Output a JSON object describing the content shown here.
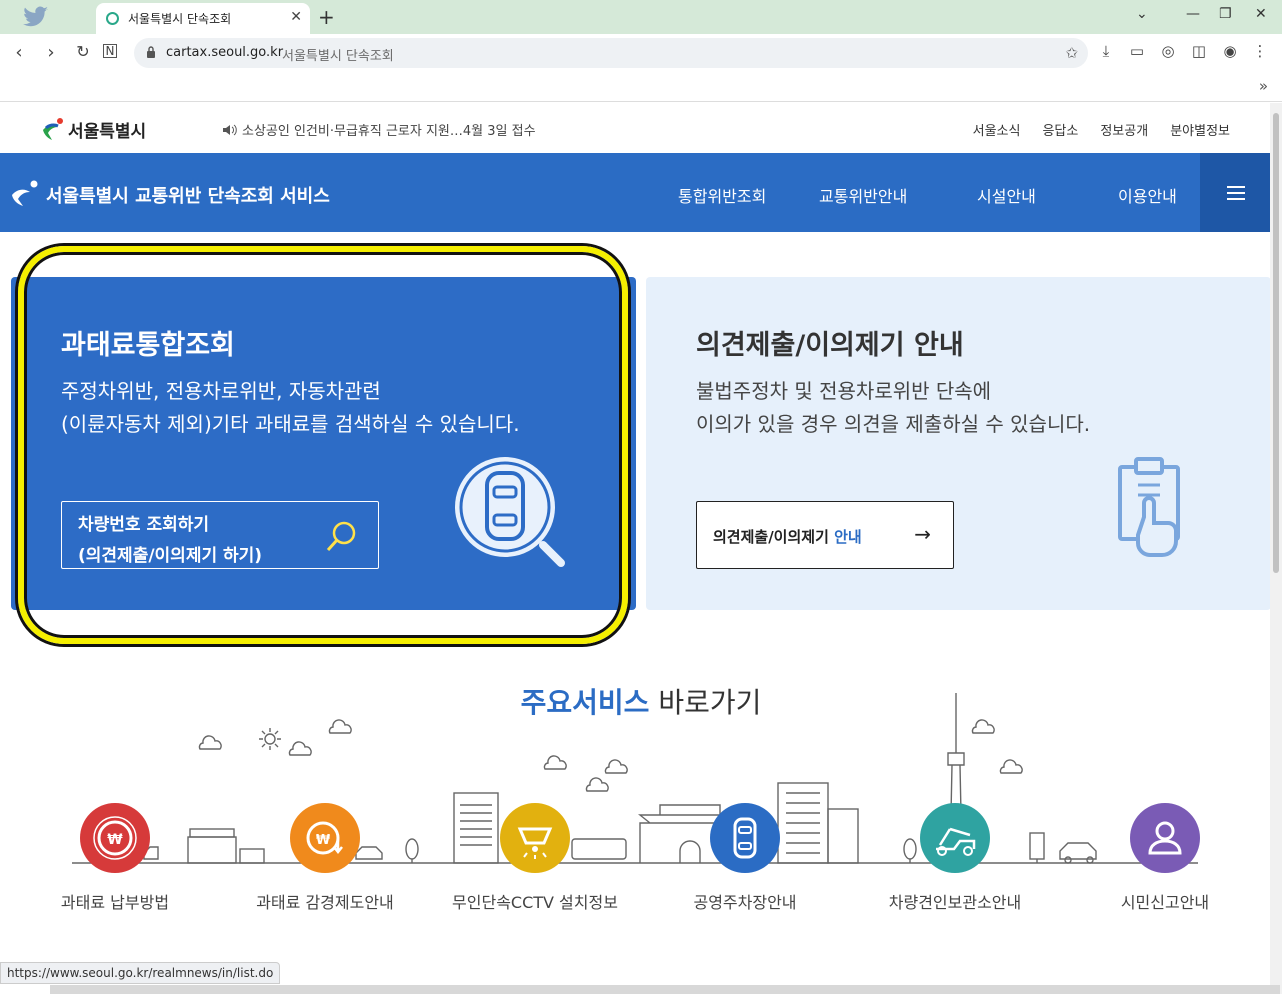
{
  "browser": {
    "tab_title": "서울특별시 단속조회",
    "new_tab": "+",
    "url_domain": "cartax.seoul.go.kr",
    "url_title": "서울특별시 단속조회",
    "bookmarks_more": "»",
    "status_url": "https://www.seoul.go.kr/realmnews/in/list.do"
  },
  "site": {
    "logo_text": "서울특별시",
    "notice": "소상공인 인건비·무급휴직 근로자 지원…4월 3일 접수",
    "top_links": [
      "서울소식",
      "응답소",
      "정보공개",
      "분야별정보"
    ],
    "service_title": "서울특별시 교통위반 단속조회 서비스",
    "menu": [
      "통합위반조회",
      "교통위반안내",
      "시설안내",
      "이용안내"
    ]
  },
  "card_left": {
    "heading": "과태료통합조회",
    "desc_line1": "주정차위반, 전용차로위반, 자동차관련",
    "desc_line2": "(이륜자동차 제외)기타 과태료를 검색하실 수 있습니다.",
    "button_line1": "차량번호 조회하기",
    "button_line2": "(의견제출/이의제기 하기)"
  },
  "card_right": {
    "heading": "의견제출/이의제기 안내",
    "desc_line1": "불법주정차 및 전용차로위반 단속에",
    "desc_line2": "이의가 있을 경우 의견을 제출하실 수 있습니다.",
    "button_label_a": "의견제출/이의제기",
    "button_label_b": " 안내"
  },
  "services": {
    "title_strong": "주요서비스",
    "title_rest": " 바로가기",
    "items": [
      {
        "label": "과태료 납부방법",
        "color": "#d63a3a"
      },
      {
        "label": "과태료 감경제도안내",
        "color": "#f08a1c"
      },
      {
        "label": "무인단속CCTV 설치정보",
        "color": "#e2b10f"
      },
      {
        "label": "공영주차장안내",
        "color": "#2b6cc4"
      },
      {
        "label": "차량견인보관소안내",
        "color": "#2fa3a1"
      },
      {
        "label": "시민신고안내",
        "color": "#7a5bb5"
      }
    ]
  },
  "colors": {
    "brand_blue": "#2b6cc4",
    "highlight": "#f5ef00"
  }
}
